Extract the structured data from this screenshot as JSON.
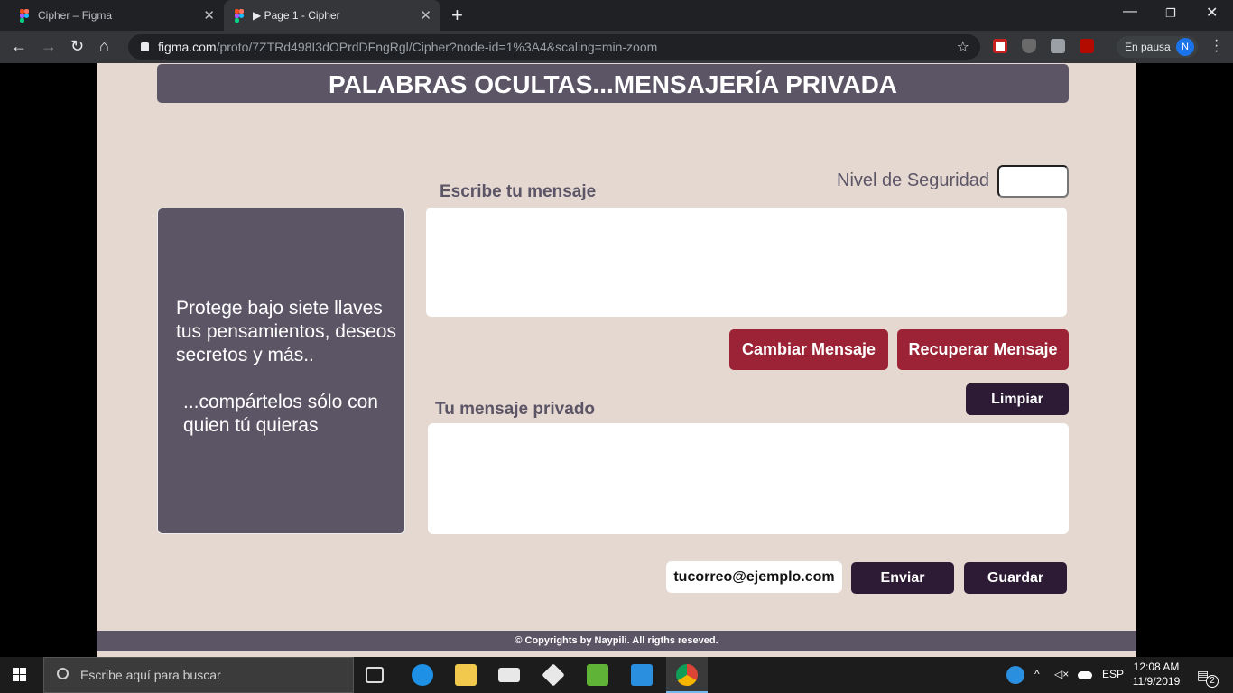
{
  "browser": {
    "tabs": [
      {
        "title": "Cipher – Figma",
        "active": false
      },
      {
        "title": "▶ Page 1 - Cipher",
        "active": true
      }
    ],
    "url_host": "figma.com",
    "url_path": "/proto/7ZTRd498I3dOPrdDFngRgl/Cipher?node-id=1%3A4&scaling=min-zoom",
    "profile_label": "En pausa",
    "profile_initial": "N"
  },
  "app": {
    "title": "PALABRAS OCULTAS...MENSAJERÍA PRIVADA",
    "security_label": "Nivel de Seguridad",
    "security_value": "",
    "write_label": "Escribe tu mensaje",
    "write_value": "",
    "side_text_1": "Protege bajo siete llaves tus pensamientos, deseos secretos y más..",
    "side_text_2": "...compártelos sólo con  quien tú quieras",
    "btn_change": "Cambiar Mensaje",
    "btn_recover": "Recuperar Mensaje",
    "btn_clear": "Limpiar",
    "private_label": "Tu mensaje privado",
    "private_value": "",
    "email": "tucorreo@ejemplo.com",
    "btn_send": "Enviar",
    "btn_save": "Guardar",
    "footer": "© Copyrights by Naypili. All rigths reseved.",
    "colors": {
      "primary": "#5c5566",
      "accent_red": "#9b2335",
      "dark_button": "#2d1a35",
      "background": "#e4d8d1"
    }
  },
  "taskbar": {
    "search_placeholder": "Escribe aquí para buscar",
    "language": "ESP",
    "time": "12:08 AM",
    "date": "11/9/2019",
    "notifications": "2"
  }
}
